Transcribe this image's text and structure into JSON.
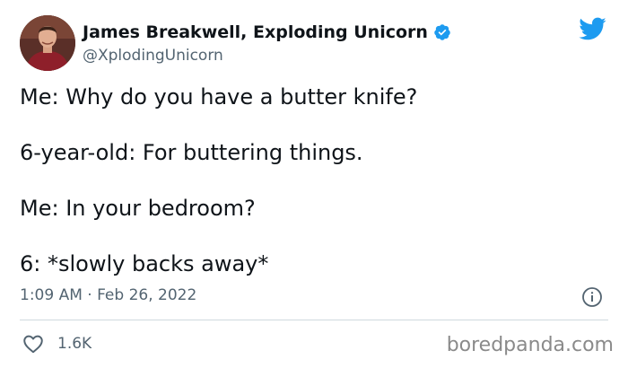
{
  "author": {
    "name": "James Breakwell, Exploding Unicorn",
    "handle": "@XplodingUnicorn",
    "verified": true
  },
  "tweet": {
    "lines": [
      "Me: Why do you have a butter knife?",
      "6-year-old: For buttering things.",
      "Me: In your bedroom?",
      "6: *slowly backs away*"
    ],
    "timestamp": "1:09 AM · Feb 26, 2022"
  },
  "engagement": {
    "likes": "1.6K"
  },
  "watermark": "boredpanda.com",
  "icons": {
    "brand": "twitter-bird-icon",
    "verified": "verified-badge-icon",
    "info": "info-icon",
    "like": "heart-icon"
  },
  "colors": {
    "twitter_blue": "#1d9bf0",
    "text_primary": "#0f1419",
    "text_secondary": "#536471",
    "divider": "#cfd9de"
  }
}
